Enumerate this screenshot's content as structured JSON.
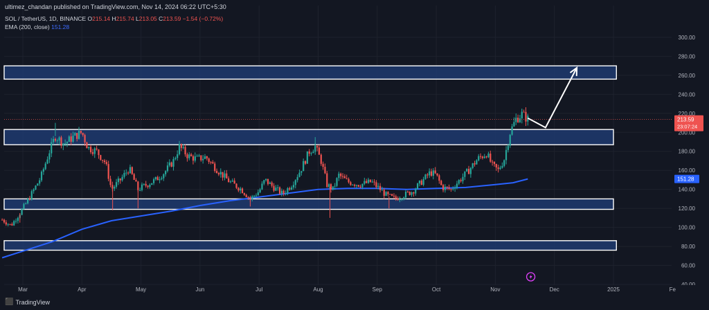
{
  "header": {
    "published": "ultimez_chandan published on TradingView.com, Nov 14, 2024 06:22 UTC+5:30"
  },
  "legend": {
    "symbol": "SOL / TetherUS, 1D, BINANCE",
    "o_label": "O",
    "o_value": "215.14",
    "h_label": "H",
    "h_value": "215.74",
    "l_label": "L",
    "l_value": "213.05",
    "c_label": "C",
    "c_value": "213.59",
    "change": "−1.54 (−0.72%)",
    "ema_label": "EMA (200, close)",
    "ema_value": "151.28"
  },
  "footer": {
    "brand": "TradingView"
  },
  "colors": {
    "up": "#26a69a",
    "down": "#ef5350",
    "ema": "#2962ff",
    "zone": "#1e3a6e",
    "bg": "#131722"
  },
  "chart_data": {
    "type": "candlestick",
    "y_ticks": [
      "300.00",
      "280.00",
      "260.00",
      "240.00",
      "220.00",
      "200.00",
      "180.00",
      "160.00",
      "140.00",
      "120.00",
      "100.00",
      "80.00",
      "60.00",
      "40.00"
    ],
    "y_values": [
      300,
      280,
      260,
      240,
      220,
      200,
      180,
      160,
      140,
      120,
      100,
      80,
      60,
      40
    ],
    "ylim": [
      32,
      310
    ],
    "x_ticks": [
      "Mar",
      "Apr",
      "May",
      "Jun",
      "Jul",
      "Aug",
      "Sep",
      "Oct",
      "Nov",
      "Dec",
      "2025",
      "Fe"
    ],
    "x_tick_months": [
      0,
      1,
      2,
      3,
      4,
      5,
      6,
      7,
      8,
      9,
      10,
      11
    ],
    "last_price": "213.59",
    "countdown": "23:07:24",
    "ema_badge": "151.28",
    "zones": [
      {
        "from_month": -0.35,
        "to_month": 10.05,
        "low": 256,
        "high": 270
      },
      {
        "from_month": -0.35,
        "to_month": 10.0,
        "low": 187,
        "high": 203
      },
      {
        "from_month": -0.35,
        "to_month": 10.0,
        "low": 119,
        "high": 130
      },
      {
        "from_month": -0.35,
        "to_month": 10.05,
        "low": 76,
        "high": 86
      }
    ],
    "arrow": [
      {
        "month": 8.55,
        "price": 215
      },
      {
        "month": 8.85,
        "price": 205
      },
      {
        "month": 9.38,
        "price": 268
      }
    ],
    "ema_line": [
      {
        "m": -0.35,
        "p": 68
      },
      {
        "m": 0.0,
        "p": 75
      },
      {
        "m": 0.5,
        "p": 85
      },
      {
        "m": 1.0,
        "p": 98
      },
      {
        "m": 1.5,
        "p": 107
      },
      {
        "m": 2.0,
        "p": 112
      },
      {
        "m": 2.5,
        "p": 117
      },
      {
        "m": 3.0,
        "p": 123
      },
      {
        "m": 3.5,
        "p": 128
      },
      {
        "m": 4.0,
        "p": 132
      },
      {
        "m": 4.5,
        "p": 136
      },
      {
        "m": 5.0,
        "p": 140
      },
      {
        "m": 5.5,
        "p": 141
      },
      {
        "m": 6.0,
        "p": 141
      },
      {
        "m": 6.5,
        "p": 140
      },
      {
        "m": 7.0,
        "p": 141
      },
      {
        "m": 7.5,
        "p": 142
      },
      {
        "m": 8.0,
        "p": 145
      },
      {
        "m": 8.3,
        "p": 147
      },
      {
        "m": 8.55,
        "p": 151
      }
    ],
    "price_path": [
      {
        "m": -0.35,
        "p": 108
      },
      {
        "m": -0.2,
        "p": 102
      },
      {
        "m": -0.05,
        "p": 115
      },
      {
        "m": 0.1,
        "p": 130
      },
      {
        "m": 0.3,
        "p": 152
      },
      {
        "m": 0.45,
        "p": 180
      },
      {
        "m": 0.55,
        "p": 196
      },
      {
        "m": 0.7,
        "p": 188
      },
      {
        "m": 0.85,
        "p": 195
      },
      {
        "m": 1.0,
        "p": 200
      },
      {
        "m": 1.1,
        "p": 184
      },
      {
        "m": 1.25,
        "p": 180
      },
      {
        "m": 1.4,
        "p": 168
      },
      {
        "m": 1.5,
        "p": 140
      },
      {
        "m": 1.65,
        "p": 150
      },
      {
        "m": 1.8,
        "p": 162
      },
      {
        "m": 1.95,
        "p": 140
      },
      {
        "m": 2.1,
        "p": 145
      },
      {
        "m": 2.25,
        "p": 150
      },
      {
        "m": 2.4,
        "p": 158
      },
      {
        "m": 2.55,
        "p": 170
      },
      {
        "m": 2.65,
        "p": 185
      },
      {
        "m": 2.8,
        "p": 175
      },
      {
        "m": 2.95,
        "p": 172
      },
      {
        "m": 3.1,
        "p": 174
      },
      {
        "m": 3.3,
        "p": 160
      },
      {
        "m": 3.5,
        "p": 148
      },
      {
        "m": 3.7,
        "p": 140
      },
      {
        "m": 3.85,
        "p": 130
      },
      {
        "m": 4.0,
        "p": 138
      },
      {
        "m": 4.1,
        "p": 150
      },
      {
        "m": 4.25,
        "p": 142
      },
      {
        "m": 4.4,
        "p": 135
      },
      {
        "m": 4.55,
        "p": 145
      },
      {
        "m": 4.7,
        "p": 160
      },
      {
        "m": 4.85,
        "p": 180
      },
      {
        "m": 4.95,
        "p": 185
      },
      {
        "m": 5.05,
        "p": 170
      },
      {
        "m": 5.15,
        "p": 145
      },
      {
        "m": 5.25,
        "p": 140
      },
      {
        "m": 5.35,
        "p": 155
      },
      {
        "m": 5.5,
        "p": 148
      },
      {
        "m": 5.7,
        "p": 145
      },
      {
        "m": 5.9,
        "p": 148
      },
      {
        "m": 6.05,
        "p": 140
      },
      {
        "m": 6.15,
        "p": 134
      },
      {
        "m": 6.3,
        "p": 130
      },
      {
        "m": 6.45,
        "p": 134
      },
      {
        "m": 6.6,
        "p": 138
      },
      {
        "m": 6.75,
        "p": 148
      },
      {
        "m": 6.9,
        "p": 158
      },
      {
        "m": 7.0,
        "p": 155
      },
      {
        "m": 7.1,
        "p": 142
      },
      {
        "m": 7.25,
        "p": 140
      },
      {
        "m": 7.4,
        "p": 150
      },
      {
        "m": 7.55,
        "p": 160
      },
      {
        "m": 7.7,
        "p": 172
      },
      {
        "m": 7.85,
        "p": 178
      },
      {
        "m": 7.95,
        "p": 165
      },
      {
        "m": 8.05,
        "p": 160
      },
      {
        "m": 8.15,
        "p": 172
      },
      {
        "m": 8.25,
        "p": 200
      },
      {
        "m": 8.35,
        "p": 214
      },
      {
        "m": 8.45,
        "p": 219
      },
      {
        "m": 8.55,
        "p": 214
      }
    ],
    "wicks": [
      {
        "m": 0.55,
        "p": 210
      },
      {
        "m": 0.95,
        "p": 205
      },
      {
        "m": 1.52,
        "p": 118
      },
      {
        "m": 1.95,
        "p": 120
      },
      {
        "m": 3.85,
        "p": 122
      },
      {
        "m": 4.95,
        "p": 195
      },
      {
        "m": 5.2,
        "p": 110
      },
      {
        "m": 6.2,
        "p": 120
      },
      {
        "m": 8.45,
        "p": 225
      },
      {
        "m": -0.05,
        "p": 105
      }
    ],
    "logo_badge_month": 8.6
  }
}
